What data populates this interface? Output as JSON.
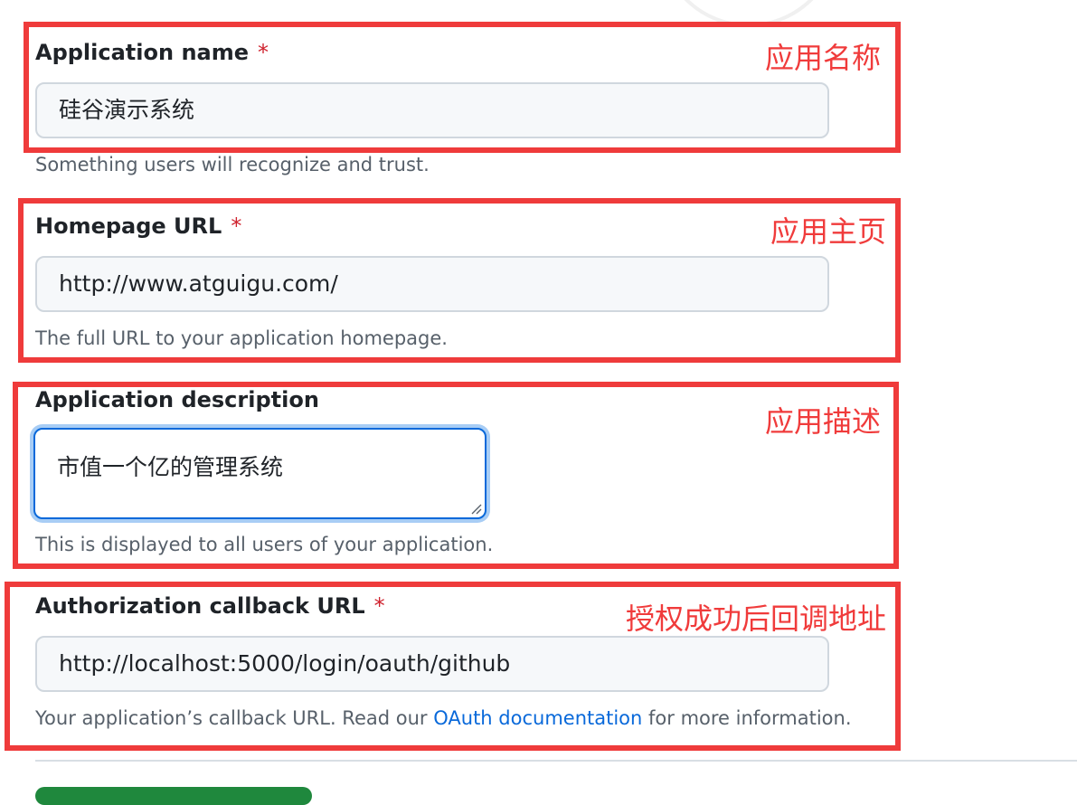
{
  "form": {
    "app_name": {
      "label": "Application name",
      "required_mark": "*",
      "value": "硅谷演示系统",
      "hint": "Something users will recognize and trust."
    },
    "homepage_url": {
      "label": "Homepage URL",
      "required_mark": "*",
      "value": "http://www.atguigu.com/",
      "hint": "The full URL to your application homepage."
    },
    "description": {
      "label": "Application description",
      "value": "市值一个亿的管理系统",
      "hint": "This is displayed to all users of your application."
    },
    "callback_url": {
      "label": "Authorization callback URL",
      "required_mark": "*",
      "value": "http://localhost:5000/login/oauth/github",
      "hint_before": "Your application’s callback URL. Read our ",
      "hint_link": "OAuth documentation",
      "hint_after": " for more information."
    }
  },
  "annotations": {
    "app_name": "应用名称",
    "homepage": "应用主页",
    "description": "应用描述",
    "callback": "授权成功后回调地址"
  },
  "colors": {
    "annotation_red": "#ef3b3b",
    "link_blue": "#0969da",
    "required_red": "#cf222e",
    "submit_green": "#1f883d"
  }
}
